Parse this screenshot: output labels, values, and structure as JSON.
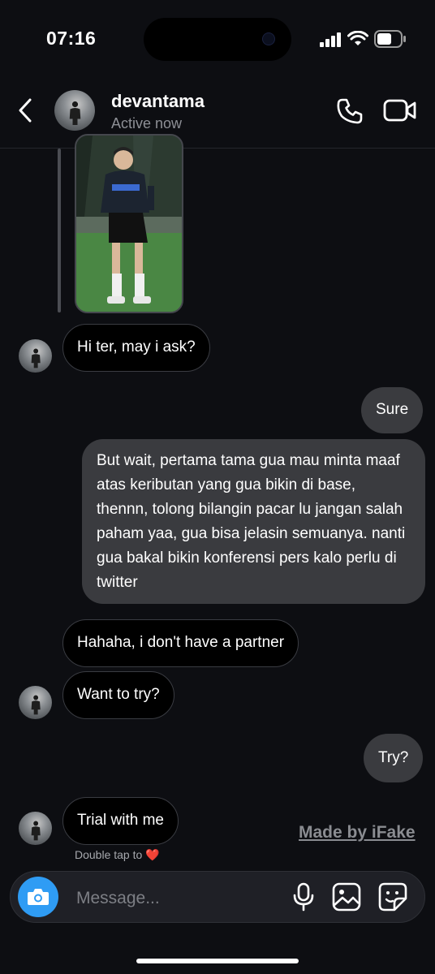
{
  "status_bar": {
    "time": "07:16"
  },
  "header": {
    "username": "devantama",
    "status": "Active now"
  },
  "messages": [
    {
      "side": "in",
      "text": "Hi ter, may i ask?"
    },
    {
      "side": "out",
      "text": "Sure"
    },
    {
      "side": "out",
      "text": "But wait, pertama tama gua mau minta maaf atas keributan yang gua bikin di base, thennn, tolong bilangin pacar lu jangan salah paham yaa, gua bisa jelasin semuanya. nanti gua bakal bikin konferensi pers kalo perlu di twitter"
    },
    {
      "side": "in",
      "text": "Hahaha, i don't have a partner"
    },
    {
      "side": "in",
      "text": "Want to try?"
    },
    {
      "side": "out",
      "text": "Try?"
    },
    {
      "side": "in",
      "text": "Trial with me"
    }
  ],
  "hint": "Double tap to ❤️",
  "watermark": "Made by iFake",
  "composer": {
    "placeholder": "Message..."
  },
  "icons": [
    "back-chevron-icon",
    "phone-icon",
    "video-camera-icon",
    "camera-icon",
    "microphone-icon",
    "gallery-icon",
    "sticker-icon",
    "signal-icon",
    "wifi-icon",
    "battery-icon"
  ],
  "colors": {
    "background": "#0d0e12",
    "incoming_bubble": "#000000",
    "outgoing_bubble": "#3a3b3f",
    "accent": "#2f9cf4"
  }
}
